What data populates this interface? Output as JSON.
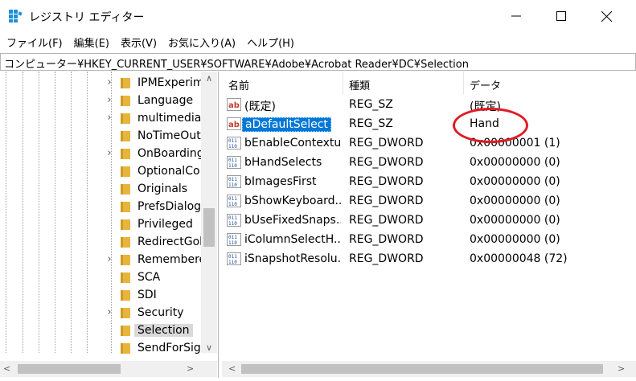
{
  "window": {
    "title": "レジストリ エディター",
    "controls": {
      "minimize": "─",
      "maximize": "☐",
      "close": "✕"
    }
  },
  "menu": [
    "ファイル(F)",
    "編集(E)",
    "表示(V)",
    "お気に入り(A)",
    "ヘルプ(H)"
  ],
  "address": "コンピューター¥HKEY_CURRENT_USER¥SOFTWARE¥Adobe¥Acrobat Reader¥DC¥Selection",
  "tree": {
    "items": [
      {
        "label": "IPMExperim",
        "expandable": true
      },
      {
        "label": "Language",
        "expandable": true
      },
      {
        "label": "multimedia",
        "expandable": true
      },
      {
        "label": "NoTimeOut",
        "expandable": false
      },
      {
        "label": "OnBoarding",
        "expandable": true
      },
      {
        "label": "OptionalCo",
        "expandable": false
      },
      {
        "label": "Originals",
        "expandable": false
      },
      {
        "label": "PrefsDialog",
        "expandable": false
      },
      {
        "label": "Privileged",
        "expandable": false
      },
      {
        "label": "RedirectGol",
        "expandable": false
      },
      {
        "label": "Remembere",
        "expandable": true
      },
      {
        "label": "SCA",
        "expandable": false
      },
      {
        "label": "SDI",
        "expandable": false
      },
      {
        "label": "Security",
        "expandable": true
      },
      {
        "label": "Selection",
        "expandable": false,
        "selected": true
      },
      {
        "label": "SendForSigr",
        "expandable": false
      }
    ],
    "expander_glyph": "›",
    "scroll_up": "∧",
    "scroll_down": "∨",
    "scroll_left": "<",
    "scroll_right": ">"
  },
  "list": {
    "headers": {
      "name": "名前",
      "type": "種類",
      "data": "データ"
    },
    "rows": [
      {
        "icon": "string-value-icon",
        "name": "(既定)",
        "type": "REG_SZ",
        "data": "(既定)"
      },
      {
        "icon": "string-value-icon",
        "name": "aDefaultSelect",
        "type": "REG_SZ",
        "data": "Hand",
        "selected": true
      },
      {
        "icon": "binary-value-icon",
        "name": "bEnableContextu...",
        "type": "REG_DWORD",
        "data": "0x00000001 (1)"
      },
      {
        "icon": "binary-value-icon",
        "name": "bHandSelects",
        "type": "REG_DWORD",
        "data": "0x00000000 (0)"
      },
      {
        "icon": "binary-value-icon",
        "name": "bImagesFirst",
        "type": "REG_DWORD",
        "data": "0x00000000 (0)"
      },
      {
        "icon": "binary-value-icon",
        "name": "bShowKeyboard...",
        "type": "REG_DWORD",
        "data": "0x00000000 (0)"
      },
      {
        "icon": "binary-value-icon",
        "name": "bUseFixedSnaps...",
        "type": "REG_DWORD",
        "data": "0x00000000 (0)"
      },
      {
        "icon": "binary-value-icon",
        "name": "iColumnSelectH...",
        "type": "REG_DWORD",
        "data": "0x00000000 (0)"
      },
      {
        "icon": "binary-value-icon",
        "name": "iSnapshotResolu...",
        "type": "REG_DWORD",
        "data": "0x00000048 (72)"
      }
    ],
    "scroll_left": "<",
    "scroll_right": ">"
  },
  "colors": {
    "selection_blue": "#0078d7",
    "annotation_red": "#e01b24",
    "folder_yellow": "#e8b53c",
    "border": "#b5b5b5"
  }
}
